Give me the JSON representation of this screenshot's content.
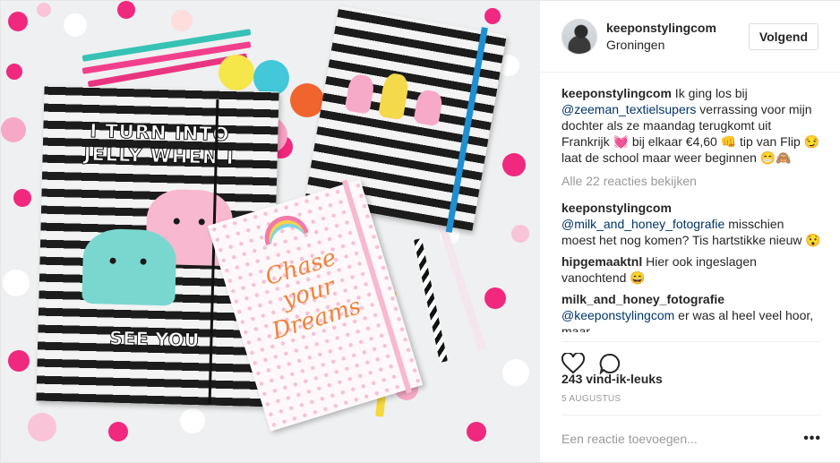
{
  "post": {
    "username": "keeponstylingcom",
    "location": "Groningen",
    "follow_label": "Volgend"
  },
  "photo": {
    "notebook_left_headline": "I TURN INTO JELLY WHEN I",
    "notebook_left_footer": "SEE YOU",
    "notebook_pink_script": "Chase your Dreams"
  },
  "caption": {
    "username": "keeponstylingcom",
    "part1": " Ik ging los bij ",
    "mention": "@zeeman_textielsupers",
    "part2": " verrassing voor mijn dochter als ze maandag terugkomt uit Frankrijk 💓 bij elkaar €4,60 👊 tip van Flip 😏 laat de school maar weer beginnen 😁🙈"
  },
  "view_all_comments": "Alle 22 reacties bekijken",
  "comments": [
    {
      "username": "keeponstylingcom",
      "mention": "@milk_and_honey_fotografie",
      "text": " misschien moest het nog komen? Tis hartstikke nieuw 😯"
    },
    {
      "username": "hipgemaaktnl",
      "mention": "",
      "text": "Hier ook ingeslagen vanochtend 😄"
    },
    {
      "username": "milk_and_honey_fotografie",
      "mention": "@keeponstylingcom",
      "text": " er was al heel veel hoor, maar"
    }
  ],
  "likes": "243 vind-ik-leuks",
  "date": "5 AUGUSTUS",
  "add_comment_placeholder": "Een reactie toevoegen...",
  "more_options": "•••",
  "icons": {
    "like": "heart-icon",
    "comment": "speech-bubble-icon"
  },
  "colors": {
    "mention": "#003569",
    "muted": "#999999",
    "notebook_strap": "#1f8fd1",
    "confetti_pink": "#f0287e"
  }
}
